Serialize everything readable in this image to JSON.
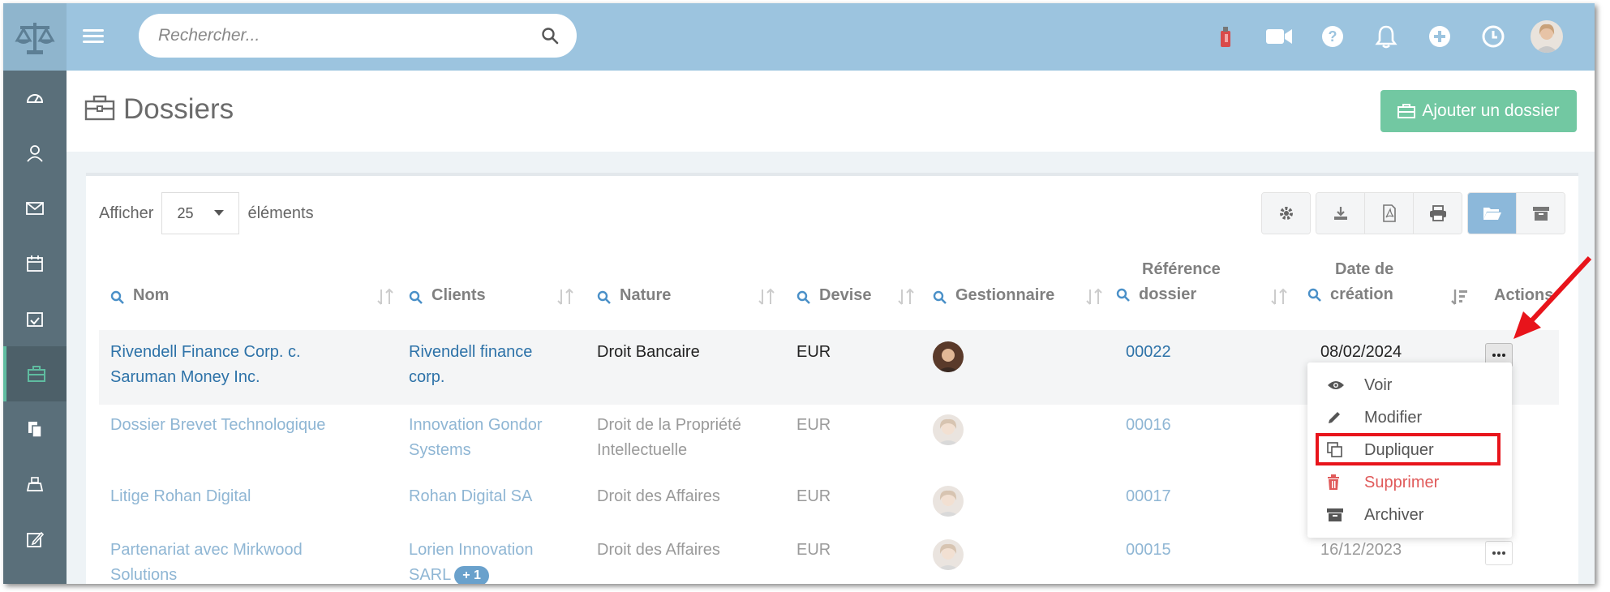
{
  "search": {
    "placeholder": "Rechercher..."
  },
  "page": {
    "title": "Dossiers",
    "add_button_label": "Ajouter un dossier"
  },
  "list_controls": {
    "show_label": "Afficher",
    "page_size": "25",
    "items_label": "éléments"
  },
  "columns": {
    "nom": "Nom",
    "clients": "Clients",
    "nature": "Nature",
    "devise": "Devise",
    "gestionnaire": "Gestionnaire",
    "reference_line1": "Référence",
    "reference_line2": "dossier",
    "date_line1": "Date de",
    "date_line2": "création",
    "actions": "Actions"
  },
  "rows": [
    {
      "nom_1": "Rivendell Finance Corp. c.",
      "nom_2": "Saruman Money Inc.",
      "client_1": "Rivendell finance",
      "client_2": "corp.",
      "nature_1": "Droit Bancaire",
      "nature_2": "",
      "devise": "EUR",
      "reference": "00022",
      "date": "08/02/2024"
    },
    {
      "nom_1": "Dossier Brevet Technologique",
      "nom_2": "",
      "client_1": "Innovation Gondor",
      "client_2": "Systems",
      "nature_1": "Droit de la Propriété",
      "nature_2": "Intellectuelle",
      "devise": "EUR",
      "reference": "00016",
      "date": ""
    },
    {
      "nom_1": "Litige Rohan Digital",
      "nom_2": "",
      "client_1": "Rohan Digital SA",
      "client_2": "",
      "nature_1": "Droit des Affaires",
      "nature_2": "",
      "devise": "EUR",
      "reference": "00017",
      "date": ""
    },
    {
      "nom_1": "Partenariat avec Mirkwood",
      "nom_2": "Solutions",
      "client_1": "Lorien Innovation",
      "client_2": "SARL",
      "client_badge": "+ 1",
      "nature_1": "Droit des Affaires",
      "nature_2": "",
      "devise": "EUR",
      "reference": "00015",
      "date": "16/12/2023"
    }
  ],
  "actions_menu": [
    {
      "label": "Voir",
      "icon": "eye-icon"
    },
    {
      "label": "Modifier",
      "icon": "pencil-icon"
    },
    {
      "label": "Dupliquer",
      "icon": "copy-icon"
    },
    {
      "label": "Supprimer",
      "icon": "trash-icon"
    },
    {
      "label": "Archiver",
      "icon": "archive-icon"
    }
  ],
  "colors": {
    "topbar": "#9cc4df",
    "sidebar": "#5a6f7a",
    "accent_green": "#72c8a2",
    "link": "#2d72a8",
    "danger": "#e05a5a",
    "highlight": "#e8141b"
  }
}
